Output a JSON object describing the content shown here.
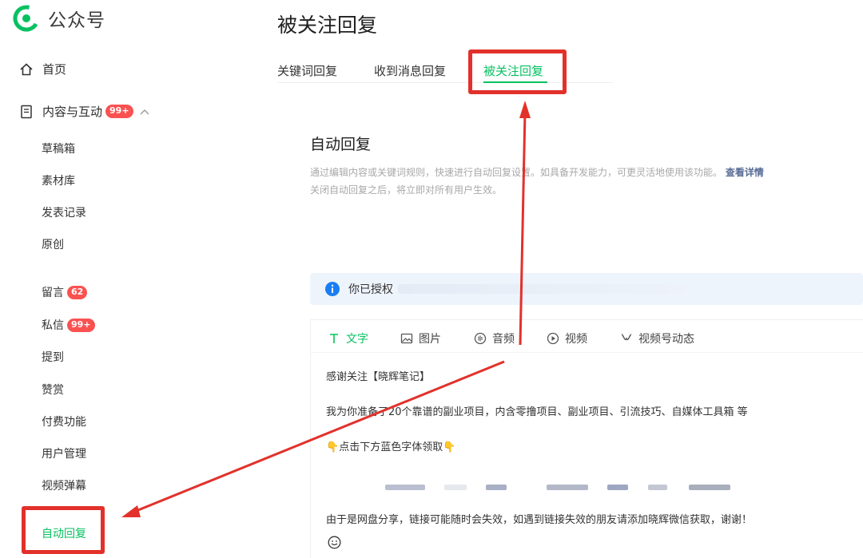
{
  "brand": {
    "name": "公众号"
  },
  "sidebar": {
    "home": {
      "label": "首页",
      "icon": "home-icon"
    },
    "content": {
      "label": "内容与互动",
      "badge": "99+",
      "icon": "document-icon"
    },
    "content_items": [
      {
        "label": "草稿箱"
      },
      {
        "label": "素材库"
      },
      {
        "label": "发表记录"
      },
      {
        "label": "原创"
      }
    ],
    "interaction_items": [
      {
        "label": "留言",
        "badge": "62"
      },
      {
        "label": "私信",
        "badge": "99+"
      },
      {
        "label": "提到"
      },
      {
        "label": "赞赏"
      },
      {
        "label": "付费功能"
      },
      {
        "label": "用户管理"
      },
      {
        "label": "视频弹幕"
      }
    ],
    "active_item": {
      "label": "自动回复"
    }
  },
  "main": {
    "title": "被关注回复",
    "tabs": [
      {
        "label": "关键词回复"
      },
      {
        "label": "收到消息回复"
      },
      {
        "label": "被关注回复",
        "active": true
      }
    ],
    "section": {
      "title": "自动回复",
      "desc_line1": "通过编辑内容或关键词规则，快速进行自动回复设置。如具备开发能力，可更灵活地使用该功能。",
      "desc_link": "查看详情",
      "desc_line2": "关闭自动回复之后，将立即对所有用户生效。"
    },
    "info": {
      "text": "你已授权"
    },
    "editor": {
      "tools": [
        {
          "label": "文字",
          "icon": "text-icon",
          "active": true
        },
        {
          "label": "图片",
          "icon": "image-icon"
        },
        {
          "label": "音频",
          "icon": "audio-icon"
        },
        {
          "label": "视频",
          "icon": "video-icon"
        },
        {
          "label": "视频号动态",
          "icon": "channels-icon"
        }
      ],
      "lines": {
        "line1": "感谢关注【晓辉笔记】",
        "line2": "我为你准备了20个靠谱的副业项目，内含零撸项目、副业项目、引流技巧、自媒体工具箱 等",
        "line3_emoji": "👇",
        "line3_text": "点击下方蓝色字体领取",
        "line4": "由于是网盘分享，链接可能随时会失效，如遇到链接失效的朋友请添加晓辉微信获取，谢谢！"
      }
    }
  },
  "colors": {
    "accent": "#07c160",
    "badge": "#fa5151",
    "annotation": "#e2312b",
    "link": "#576b95"
  }
}
